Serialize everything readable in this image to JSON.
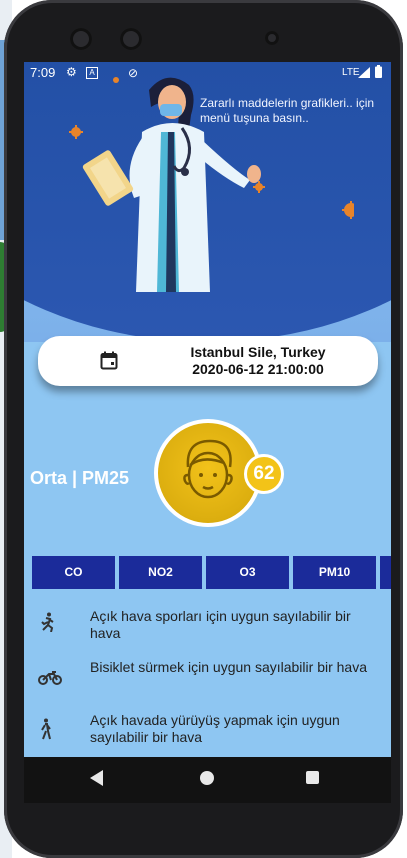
{
  "status_bar": {
    "time": "7:09",
    "network": "LTE"
  },
  "header": {
    "hint_text": "Zararlı maddelerin grafikleri.. için menü tuşuna basın.."
  },
  "location": {
    "place": "Istanbul Sile, Turkey",
    "datetime": "2020-06-12 21:00:00",
    "icon": "calendar-icon"
  },
  "air_quality": {
    "label": "Orta | PM25",
    "score": "62",
    "face_icon": "face-icon",
    "accent": "#f2c21a"
  },
  "pollutant_tabs": [
    {
      "label": "CO"
    },
    {
      "label": "NO2"
    },
    {
      "label": "O3"
    },
    {
      "label": "PM10"
    }
  ],
  "advice": [
    {
      "icon": "running-icon",
      "text": "Açık hava sporları için uygun sayılabilir bir hava"
    },
    {
      "icon": "motorcycle-icon",
      "text": "Bisiklet sürmek için uygun sayılabilir bir hava"
    },
    {
      "icon": "walking-icon",
      "text": "Açık havada yürüyüş yapmak için uygun sayılabilir bir hava"
    }
  ],
  "colors": {
    "hero": "#2350a6",
    "background": "#8ec6f2",
    "tab": "#1b2b9a"
  }
}
